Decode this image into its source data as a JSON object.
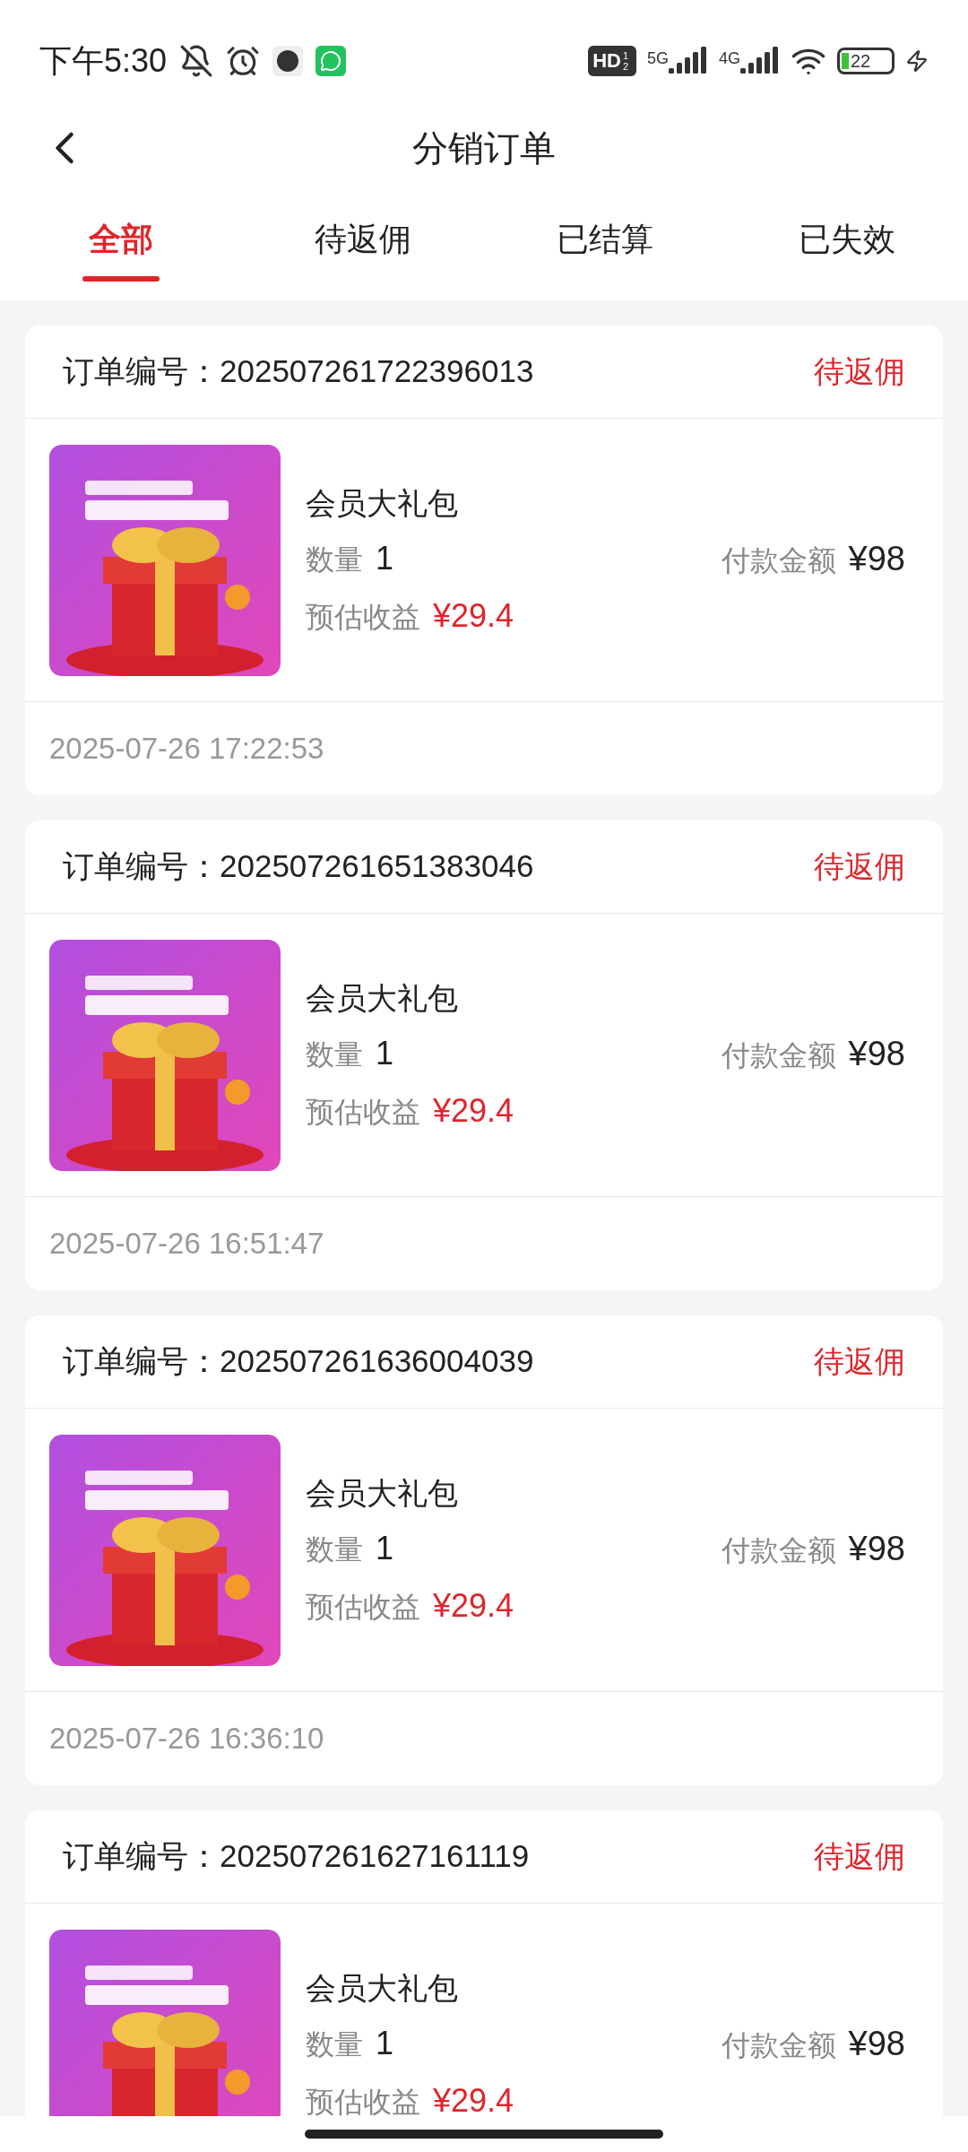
{
  "status_bar": {
    "time": "下午5:30",
    "hd": "HD",
    "hd_sub": "1 2",
    "net1": "5G",
    "net2": "4G",
    "battery": "22"
  },
  "header": {
    "title": "分销订单"
  },
  "tabs": [
    {
      "label": "全部",
      "selected": true
    },
    {
      "label": "待返佣",
      "selected": false
    },
    {
      "label": "已结算",
      "selected": false
    },
    {
      "label": "已失效",
      "selected": false
    }
  ],
  "orders": [
    {
      "number_label": "订单编号：",
      "number": "202507261722396013",
      "status": "待返佣",
      "product": "会员大礼包",
      "qty_label": "数量",
      "qty": "1",
      "income_label": "预估收益",
      "income": "¥29.4",
      "pay_label": "付款金额",
      "pay": "¥98",
      "time": "2025-07-26 17:22:53"
    },
    {
      "number_label": "订单编号：",
      "number": "202507261651383046",
      "status": "待返佣",
      "product": "会员大礼包",
      "qty_label": "数量",
      "qty": "1",
      "income_label": "预估收益",
      "income": "¥29.4",
      "pay_label": "付款金额",
      "pay": "¥98",
      "time": "2025-07-26 16:51:47"
    },
    {
      "number_label": "订单编号：",
      "number": "202507261636004039",
      "status": "待返佣",
      "product": "会员大礼包",
      "qty_label": "数量",
      "qty": "1",
      "income_label": "预估收益",
      "income": "¥29.4",
      "pay_label": "付款金额",
      "pay": "¥98",
      "time": "2025-07-26 16:36:10"
    },
    {
      "number_label": "订单编号：",
      "number": "202507261627161119",
      "status": "待返佣",
      "product": "会员大礼包",
      "qty_label": "数量",
      "qty": "1",
      "income_label": "预估收益",
      "income": "¥29.4",
      "pay_label": "付款金额",
      "pay": "¥98"
    }
  ]
}
